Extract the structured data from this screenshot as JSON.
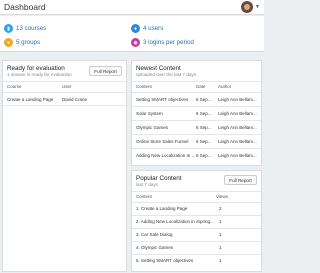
{
  "header": {
    "title": "Dashboard",
    "avatar_icon": "user-avatar-icon",
    "caret_icon": "chevron-down-icon"
  },
  "stats": {
    "courses": {
      "text": "13 courses",
      "color": "#2ea3f2",
      "icon": "book-icon"
    },
    "users": {
      "text": "4 users",
      "color": "#2b8ad9",
      "icon": "user-icon"
    },
    "groups": {
      "text": "5 groups",
      "color": "#f5a623",
      "icon": "group-icon"
    },
    "logins": {
      "text": "3 logins per period",
      "color": "#c0399b",
      "icon": "eye-icon"
    }
  },
  "ready": {
    "title": "Ready for evaluation",
    "subtitle": "1 answer is ready for evaluation",
    "button": "Full Report",
    "columns": [
      "Course",
      "User"
    ],
    "rows": [
      {
        "course": "Create a Landing Page",
        "user": "David Crane"
      }
    ]
  },
  "newest": {
    "title": "Newest Content",
    "subtitle": "uploaded over the last 7 days",
    "columns": [
      "Content",
      "Date",
      "Author"
    ],
    "rows": [
      {
        "content": "Setting SMART objectives",
        "date": "6 Sep...",
        "author": "Leigh Ann Bellam..."
      },
      {
        "content": "Solar System",
        "date": "6 Sep...",
        "author": "Leigh Ann Bellam..."
      },
      {
        "content": "Olympic Games",
        "date": "6 Sep...",
        "author": "Leigh Ann Bellam..."
      },
      {
        "content": "Online Store Sales Funnel",
        "date": "6 Sep...",
        "author": "Leigh Ann Bellam..."
      },
      {
        "content": "Adding New Localization In ...",
        "date": "6 Sep...",
        "author": "Leigh Ann Bellam..."
      }
    ]
  },
  "popular": {
    "title": "Popular Content",
    "subtitle": "last 7 days",
    "button": "Full Report",
    "columns": [
      "Content",
      "Views"
    ],
    "rows": [
      {
        "content": "1. Create a Landing Page",
        "views": "2"
      },
      {
        "content": "2. Adding New Localization in iSpring...",
        "views": "1"
      },
      {
        "content": "3. Car Sale Dialog",
        "views": "1"
      },
      {
        "content": "4. Olympic Games",
        "views": "1"
      },
      {
        "content": "5. Setting SMART objectives",
        "views": "1"
      }
    ]
  }
}
